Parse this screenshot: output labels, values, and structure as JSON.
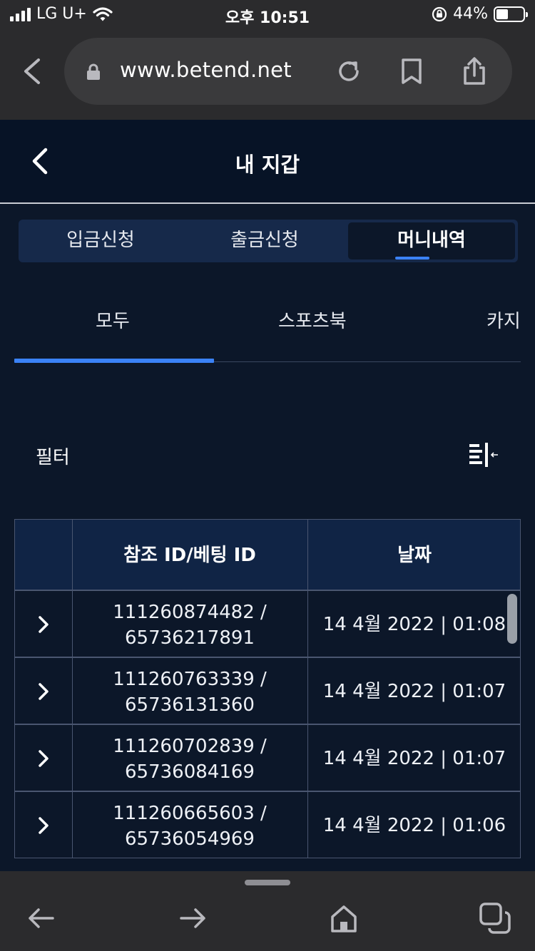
{
  "status_bar": {
    "carrier": "LG U+",
    "time": "오후 10:51",
    "battery": "44%",
    "battery_level": 0.44
  },
  "browser": {
    "url": "www.betend.net"
  },
  "header": {
    "title": "내 지갑"
  },
  "segments": [
    {
      "label": "입금신청",
      "active": false
    },
    {
      "label": "출금신청",
      "active": false
    },
    {
      "label": "머니내역",
      "active": true
    }
  ],
  "subtabs": [
    {
      "label": "모두",
      "active": true
    },
    {
      "label": "스포츠북",
      "active": false
    },
    {
      "label": "카지",
      "active": false
    }
  ],
  "filter": {
    "label": "필터"
  },
  "table": {
    "columns": [
      "",
      "참조 ID/베팅 ID",
      "날짜"
    ],
    "rows": [
      {
        "ref_line1": "111260874482 /",
        "ref_line2": "65736217891",
        "date": "14 4월 2022 | 01:08"
      },
      {
        "ref_line1": "111260763339 /",
        "ref_line2": "65736131360",
        "date": "14 4월 2022 | 01:07"
      },
      {
        "ref_line1": "111260702839 /",
        "ref_line2": "65736084169",
        "date": "14 4월 2022 | 01:07"
      },
      {
        "ref_line1": "111260665603 /",
        "ref_line2": "65736054969",
        "date": "14 4월 2022 | 01:06"
      }
    ]
  },
  "colors": {
    "background": "#0c1729",
    "accent": "#3b82f6",
    "header_bg": "#071326",
    "table_header_bg": "#102445",
    "chrome": "#2b2b2d"
  },
  "icons": {
    "browser_back": "chevron-left-icon",
    "lock": "lock-icon",
    "reload": "reload-icon",
    "bookmark": "bookmark-icon",
    "share": "share-icon",
    "filter": "filter-collapse-icon",
    "row_expand": "chevron-right-icon",
    "toolbar": [
      "arrow-left-icon",
      "arrow-right-icon",
      "home-icon",
      "tabs-icon"
    ]
  }
}
